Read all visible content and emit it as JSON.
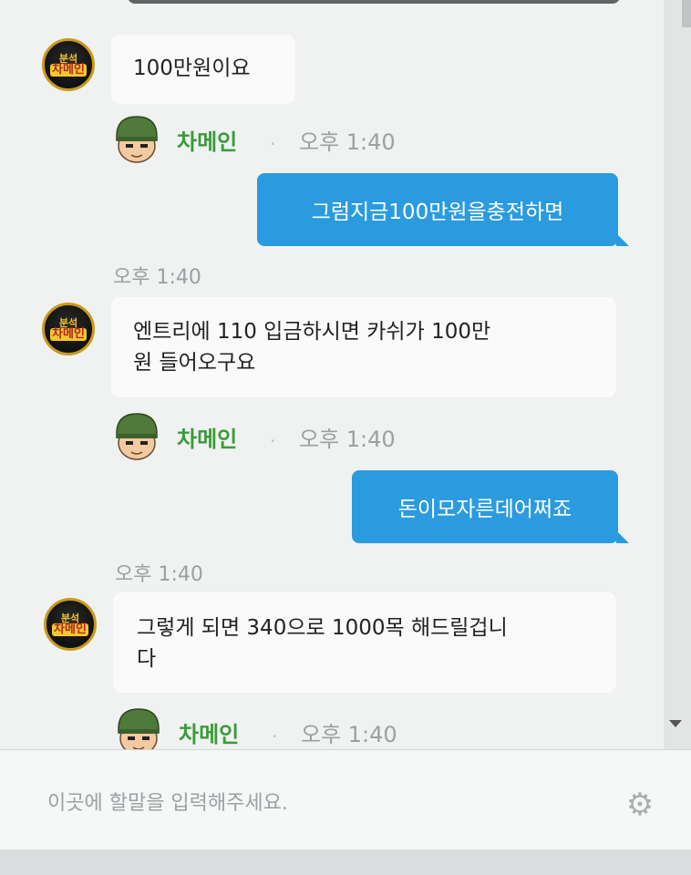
{
  "messages": [
    {
      "type": "in",
      "text": "100만원이요"
    },
    {
      "type": "sender",
      "name": "차메인",
      "time": "오후 1:40"
    },
    {
      "type": "out",
      "text": "그럼지금100만원을충전하면"
    },
    {
      "type": "timestamp",
      "time": "오후 1:40"
    },
    {
      "type": "in",
      "lines": [
        "엔트리에 110 입금하시면 카쉬가 100만",
        "원 들어오구요"
      ]
    },
    {
      "type": "sender",
      "name": "차메인",
      "time": "오후 1:40"
    },
    {
      "type": "out",
      "text": "돈이모자른데어쩌죠"
    },
    {
      "type": "timestamp",
      "time": "오후 1:40"
    },
    {
      "type": "in",
      "lines": [
        "그렇게 되면 340으로 1000목 해드릴겁니",
        "다"
      ]
    },
    {
      "type": "sender",
      "name": "차메인",
      "time": "오후 1:40"
    }
  ],
  "input": {
    "placeholder": "이곳에 할말을 입력해주세요."
  },
  "avatar_logo": {
    "line1": "분석",
    "line2": "차메인"
  },
  "separator": "."
}
